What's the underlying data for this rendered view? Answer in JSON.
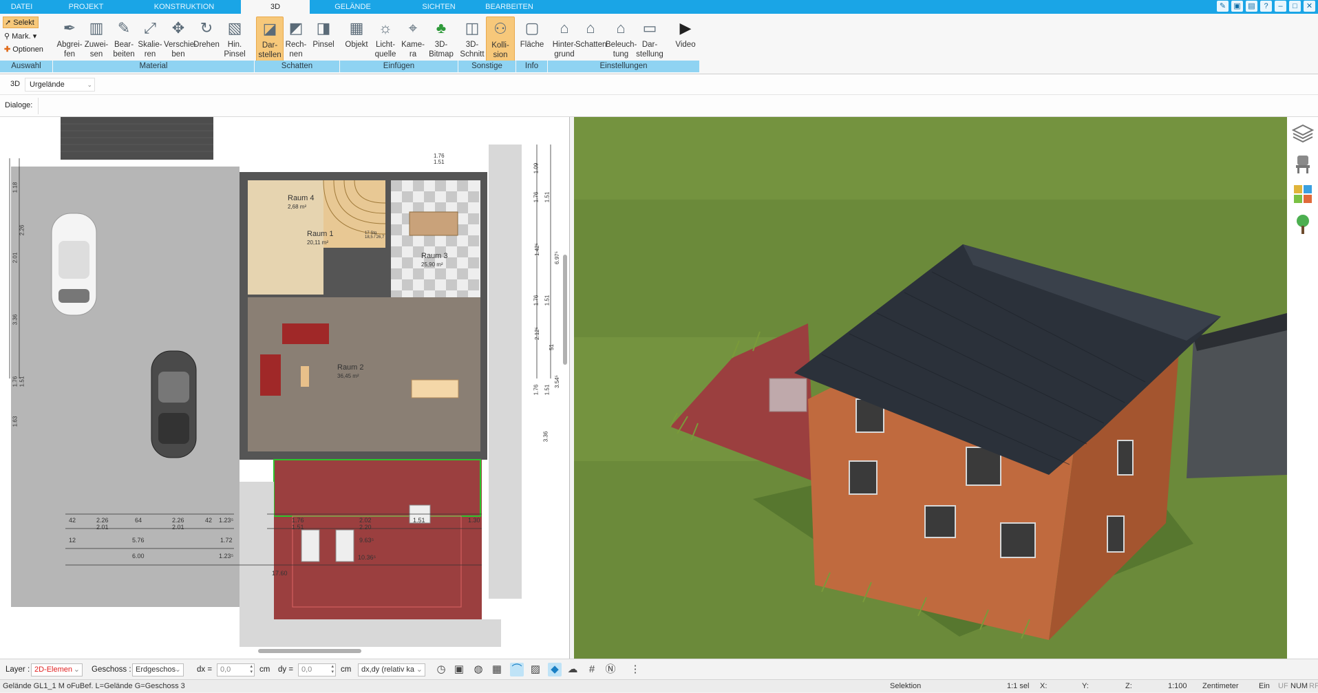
{
  "menubar": {
    "tabs": [
      "DATEI",
      "PROJEKT",
      "KONSTRUKTION",
      "3D",
      "GELÄNDE",
      "SICHTEN",
      "BEARBEITEN"
    ],
    "active_tab": "3D",
    "window_controls": [
      "tools-icon",
      "restore-icon",
      "layout-icon",
      "help-icon",
      "minimize-icon",
      "maximize-icon",
      "close-icon"
    ]
  },
  "ribbon": {
    "auswahl": {
      "selekt": "Selekt",
      "mark": "Mark.",
      "optionen": "Optionen"
    },
    "buttons": [
      {
        "label": "Abgrei-\nfen",
        "icon": "eyedropper-icon"
      },
      {
        "label": "Zuwei-\nsen",
        "icon": "assign-material-icon"
      },
      {
        "label": "Bear-\nbeiten",
        "icon": "edit-material-icon"
      },
      {
        "label": "Skalie-\nren",
        "icon": "scale-icon"
      },
      {
        "label": "Verschie-\nben",
        "icon": "move-icon"
      },
      {
        "label": "Drehen",
        "icon": "rotate-icon"
      },
      {
        "label": "Hin.\nPinsel",
        "icon": "background-brush-icon"
      },
      {
        "label": "Dar-\nstellen",
        "icon": "shadow-display-icon",
        "active": true
      },
      {
        "label": "Rech-\nnen",
        "icon": "shadow-calc-icon"
      },
      {
        "label": "Pinsel",
        "icon": "shadow-brush-icon"
      },
      {
        "label": "Objekt",
        "icon": "object-icon"
      },
      {
        "label": "Licht-\nquelle",
        "icon": "lightbulb-icon"
      },
      {
        "label": "Kame-\nra",
        "icon": "camera-icon"
      },
      {
        "label": "3D-\nBitmap",
        "icon": "tree-icon"
      },
      {
        "label": "3D-\nSchnitt",
        "icon": "section-icon"
      },
      {
        "label": "Kolli-\nsion",
        "icon": "collision-icon",
        "active": true
      },
      {
        "label": "Fläche",
        "icon": "area-icon"
      },
      {
        "label": "Hinter-\ngrund",
        "icon": "background-icon"
      },
      {
        "label": "Schatten",
        "icon": "house-shadow-icon"
      },
      {
        "label": "Beleuch-\ntung",
        "icon": "lighting-icon"
      },
      {
        "label": "Dar-\nstellung",
        "icon": "display-icon"
      },
      {
        "label": "Video",
        "icon": "play-icon"
      }
    ],
    "groups": [
      "Auswahl",
      "Material",
      "Schatten",
      "Einfügen",
      "Sonstige",
      "Info",
      "Einstellungen"
    ]
  },
  "toolbar2": {
    "mode": "3D",
    "layer_select": "Urgelände"
  },
  "toolbar3": {
    "dialoge_label": "Dialoge:"
  },
  "plan": {
    "rooms": [
      {
        "name": "Raum 4",
        "area": "2,68 m²"
      },
      {
        "name": "Raum 1",
        "area": "20,11 m²"
      },
      {
        "name": "Raum 3",
        "area": "25,90 m²"
      },
      {
        "name": "Raum 2",
        "area": "36,45 m²"
      }
    ],
    "dimensions_bottom": [
      "42",
      "2.26",
      "64",
      "2.26",
      "42",
      "1.23⁵",
      "2.01",
      "2.01",
      "12",
      "5.76",
      "1.72",
      "6.00",
      "1.23⁵",
      "1.76",
      "2.02",
      "1.51",
      "2.20",
      "1.51",
      "1.30",
      "9.63⁵",
      "10.36⁵",
      "17.60"
    ],
    "dimensions_right": [
      "1.09",
      "1.76",
      "1.51",
      "1.42⁵",
      "6.97⁵",
      "1.76",
      "1.51",
      "2.12⁵",
      "3.54⁵",
      "1.76",
      "1.51",
      "3.36",
      "51"
    ],
    "dimensions_left": [
      "1.18",
      "2.26",
      "2.01",
      "3.36",
      "1.76",
      "1.51",
      "1.63"
    ],
    "dimension_top": "1.76\n1.51",
    "stair_label": "17 Stg\n18,5 / 26,7"
  },
  "statusbar": {
    "layer_label": "Layer :",
    "layer_value": "2D-Elemen",
    "geschoss_label": "Geschoss :",
    "geschoss_value": "Erdgeschos",
    "dx_label": "dx =",
    "dx_value": "0,0",
    "dx_unit": "cm",
    "dy_label": "dy =",
    "dy_value": "0,0",
    "dy_unit": "cm",
    "mode_value": "dx,dy (relativ ka",
    "status_line": "Gelände GL1_1 M oFuBef. L=Gelände G=Geschoss 3",
    "selektion": "Selektion",
    "sel_count": "1:1 sel",
    "x_label": "X:",
    "y_label": "Y:",
    "z_label": "Z:",
    "scale": "1:100",
    "unit": "Zentimeter",
    "ein": "Ein",
    "uf": "UF",
    "num": "NUM",
    "rf": "RF"
  },
  "colors": {
    "accent": "#1aa5e6",
    "group_bar": "#8fd3f2",
    "active_button": "#f7c87a",
    "grass": "#6d8a3c",
    "roof": "#2b313a",
    "wall": "#c06a3e",
    "terrace": "#9b3f3f"
  }
}
